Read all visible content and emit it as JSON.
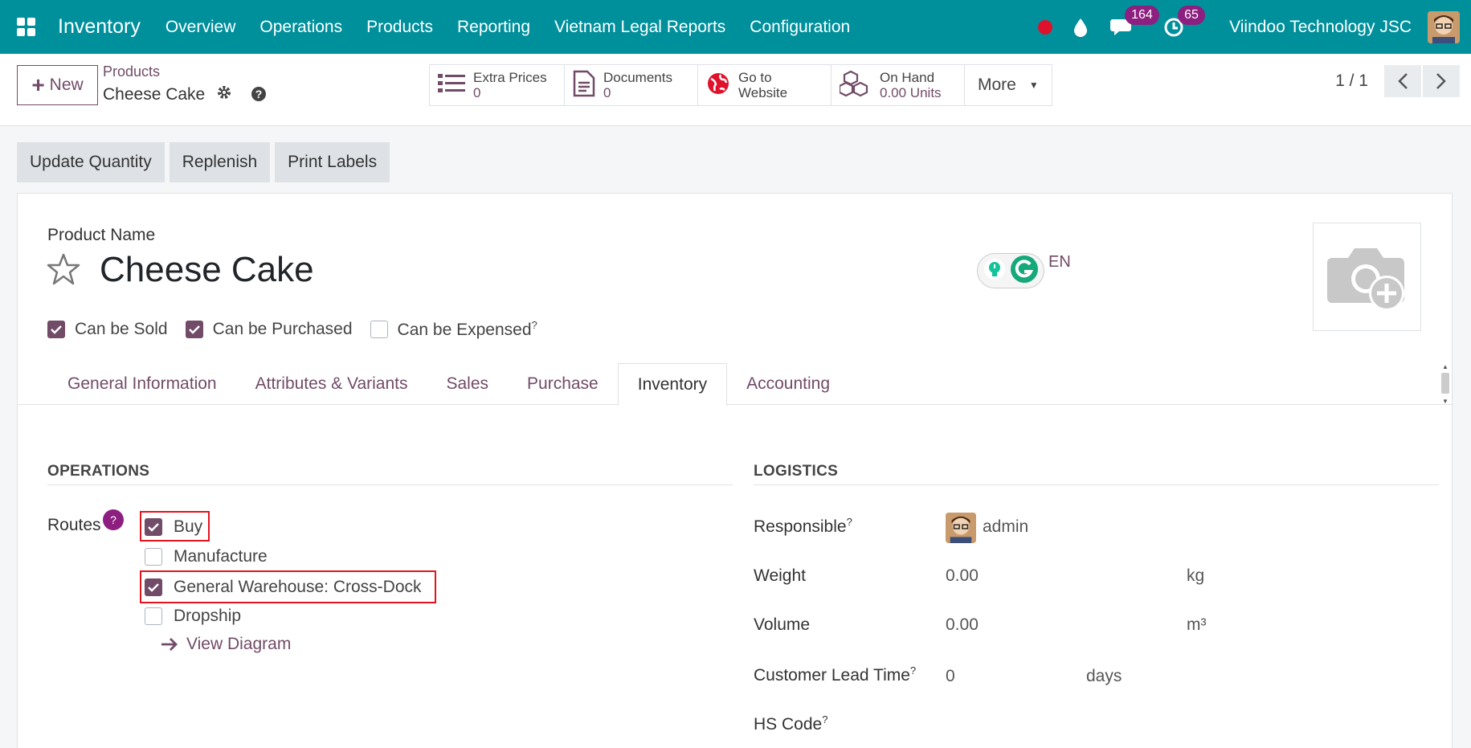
{
  "navbar": {
    "app_name": "Inventory",
    "menu": [
      "Overview",
      "Operations",
      "Products",
      "Reporting",
      "Vietnam Legal Reports",
      "Configuration"
    ],
    "messages_count": "164",
    "activities_count": "65",
    "company": "Viindoo Technology JSC"
  },
  "control": {
    "new_label": "New",
    "breadcrumb_parent": "Products",
    "breadcrumb_current": "Cheese Cake",
    "smart_buttons": [
      {
        "label": "Extra Prices",
        "value": "0"
      },
      {
        "label": "Documents",
        "value": "0"
      },
      {
        "label": "Go to",
        "label2": "Website"
      },
      {
        "label": "On Hand",
        "value": "0.00 Units"
      }
    ],
    "more_label": "More",
    "pager": "1 / 1"
  },
  "actions": [
    "Update Quantity",
    "Replenish",
    "Print Labels"
  ],
  "form": {
    "product_name_label": "Product Name",
    "product_name": "Cheese Cake",
    "lang": "EN",
    "can_be_sold": "Can be Sold",
    "can_be_purchased": "Can be Purchased",
    "can_be_expensed": "Can be Expensed",
    "help_mark": "?",
    "tabs": [
      "General Information",
      "Attributes & Variants",
      "Sales",
      "Purchase",
      "Inventory",
      "Accounting"
    ],
    "operations": {
      "title": "OPERATIONS",
      "routes_label": "Routes",
      "routes_help": "?",
      "routes": [
        {
          "label": "Buy",
          "checked": true
        },
        {
          "label": "Manufacture",
          "checked": false
        },
        {
          "label": "General Warehouse: Cross-Dock",
          "checked": true
        },
        {
          "label": "Dropship",
          "checked": false
        }
      ],
      "view_diagram": "View Diagram"
    },
    "logistics": {
      "title": "LOGISTICS",
      "responsible_label": "Responsible",
      "responsible_value": "admin",
      "weight_label": "Weight",
      "weight_value": "0.00",
      "weight_unit": "kg",
      "volume_label": "Volume",
      "volume_value": "0.00",
      "volume_unit": "m³",
      "lead_time_label": "Customer Lead Time",
      "lead_time_value": "0",
      "lead_time_unit": "days",
      "hs_code_label": "HS Code"
    }
  },
  "colors": {
    "navbar": "#00909c",
    "primary": "#714b67",
    "badge": "#8c1f7f",
    "highlight": "#e3141e"
  }
}
